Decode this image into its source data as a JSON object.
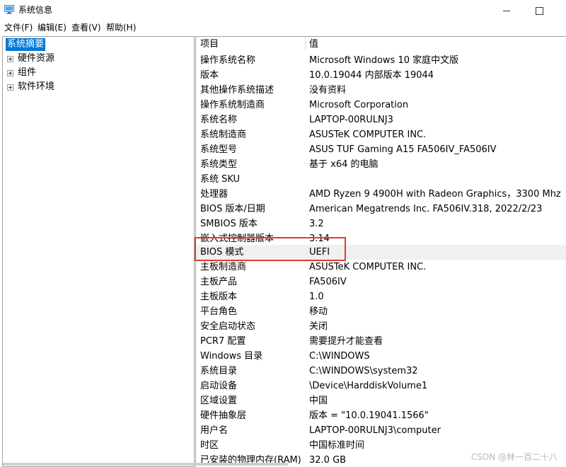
{
  "window": {
    "title": "系统信息"
  },
  "menu": [
    "文件(F)",
    "编辑(E)",
    "查看(V)",
    "帮助(H)"
  ],
  "tree": {
    "root": "系统摘要",
    "children": [
      "硬件资源",
      "组件",
      "软件环境"
    ]
  },
  "table": {
    "headers": {
      "item": "项目",
      "value": "值"
    },
    "rows": [
      {
        "key": "操作系统名称",
        "value": "Microsoft Windows 10 家庭中文版"
      },
      {
        "key": "版本",
        "value": "10.0.19044 内部版本 19044"
      },
      {
        "key": "其他操作系统描述",
        "value": "没有资料"
      },
      {
        "key": "操作系统制造商",
        "value": "Microsoft Corporation"
      },
      {
        "key": "系统名称",
        "value": "LAPTOP-00RULNJ3"
      },
      {
        "key": "系统制造商",
        "value": "ASUSTeK COMPUTER INC."
      },
      {
        "key": "系统型号",
        "value": "ASUS TUF Gaming A15 FA506IV_FA506IV"
      },
      {
        "key": "系统类型",
        "value": "基于 x64 的电脑"
      },
      {
        "key": "系统 SKU",
        "value": ""
      },
      {
        "key": "处理器",
        "value": "AMD Ryzen 9 4900H with Radeon Graphics，3300 Mhz"
      },
      {
        "key": "BIOS 版本/日期",
        "value": "American Megatrends Inc. FA506IV.318, 2022/2/23"
      },
      {
        "key": "SMBIOS 版本",
        "value": "3.2"
      },
      {
        "key": "嵌入式控制器版本",
        "value": "3.14"
      },
      {
        "key": "BIOS 模式",
        "value": "UEFI"
      },
      {
        "key": "主板制造商",
        "value": "ASUSTeK COMPUTER INC."
      },
      {
        "key": "主板产品",
        "value": "FA506IV"
      },
      {
        "key": "主板版本",
        "value": "1.0"
      },
      {
        "key": "平台角色",
        "value": "移动"
      },
      {
        "key": "安全启动状态",
        "value": "关闭"
      },
      {
        "key": "PCR7 配置",
        "value": "需要提升才能查看"
      },
      {
        "key": "Windows 目录",
        "value": "C:\\WINDOWS"
      },
      {
        "key": "系统目录",
        "value": "C:\\WINDOWS\\system32"
      },
      {
        "key": "启动设备",
        "value": "\\Device\\HarddiskVolume1"
      },
      {
        "key": "区域设置",
        "value": "中国"
      },
      {
        "key": "硬件抽象层",
        "value": "版本 = \"10.0.19041.1566\""
      },
      {
        "key": "用户名",
        "value": "LAPTOP-00RULNJ3\\computer"
      },
      {
        "key": "时区",
        "value": "中国标准时间"
      },
      {
        "key": "已安装的物理内存(RAM)",
        "value": "32.0 GB"
      }
    ]
  },
  "watermark": "CSDN @林一百二十八",
  "colors": {
    "selection": "#0078d7",
    "annotation": "#e53935"
  }
}
